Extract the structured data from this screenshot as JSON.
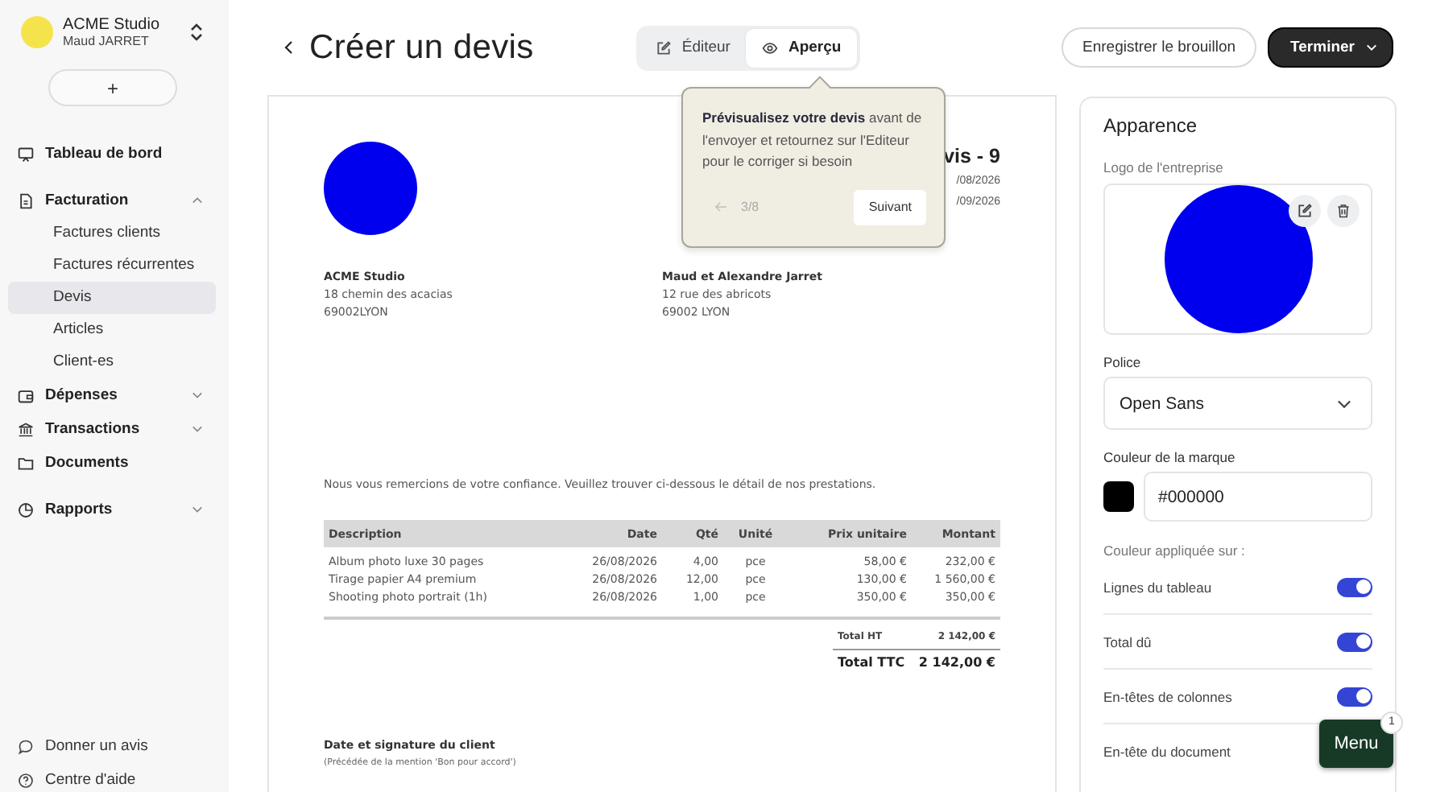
{
  "sidebar": {
    "org": {
      "name": "ACME Studio",
      "user": "Maud JARRET"
    },
    "add_button": "+",
    "nav": [
      {
        "label": "Tableau de bord",
        "selected": false
      },
      {
        "label": "Facturation",
        "selected": false,
        "expanded": true,
        "children": [
          {
            "label": "Factures clients",
            "selected": false
          },
          {
            "label": "Factures récurrentes",
            "selected": false
          },
          {
            "label": "Devis",
            "selected": true
          },
          {
            "label": "Articles",
            "selected": false
          },
          {
            "label": "Client-es",
            "selected": false
          }
        ]
      },
      {
        "label": "Dépenses",
        "selected": false,
        "expanded": false
      },
      {
        "label": "Transactions",
        "selected": false,
        "expanded": false
      },
      {
        "label": "Documents",
        "selected": false
      },
      {
        "label": "Rapports",
        "selected": false,
        "expanded": false
      }
    ],
    "footer_links": [
      "Donner un avis",
      "Centre d'aide"
    ]
  },
  "header": {
    "title": "Créer un devis",
    "view_tabs": [
      {
        "label": "Éditeur",
        "selected": false
      },
      {
        "label": "Aperçu",
        "selected": true
      }
    ],
    "save_draft": "Enregistrer le brouillon",
    "finish": "Terminer"
  },
  "tooltip": {
    "text": "**Prévisualisez votre devis** avant de l'envoyer et retournez sur l'Editeur pour le corriger si besoin",
    "step": "3/8",
    "next": "Suivant"
  },
  "document": {
    "title_partial": "vis - 9",
    "dates_partial": [
      "/08/2026",
      "/09/2026"
    ],
    "sender": {
      "name": "ACME Studio",
      "lines": [
        "18 chemin des acacias",
        "69002LYON"
      ]
    },
    "client": {
      "name": "Maud et Alexandre Jarret",
      "lines": [
        "12 rue des abricots",
        "69002 LYON"
      ]
    },
    "intro": "Nous vous remercions de votre confiance. Veuillez trouver ci-dessous le détail de nos prestations.",
    "table": {
      "columns": [
        "Description",
        "Date",
        "Qté",
        "Unité",
        "Prix unitaire",
        "Montant"
      ],
      "rows": [
        [
          "Album photo luxe 30 pages",
          "26/08/2026",
          "4,00",
          "pce",
          "58,00 €",
          "232,00 €"
        ],
        [
          "Tirage papier A4 premium",
          "26/08/2026",
          "12,00",
          "pce",
          "130,00 €",
          "1 560,00 €"
        ],
        [
          "Shooting photo portrait (1h)",
          "26/08/2026",
          "1,00",
          "pce",
          "350,00 €",
          "350,00 €"
        ]
      ]
    },
    "totals": [
      {
        "kind": "subtotal",
        "label": "Total HT",
        "value": "2 142,00 €"
      },
      {
        "kind": "grand",
        "label": "Total TTC",
        "value": "2 142,00 €"
      }
    ],
    "signature": {
      "title": "Date et signature du client",
      "note": "(Précédée de la mention 'Bon pour accord')"
    }
  },
  "appearance": {
    "title": "Apparence",
    "logo_label": "Logo de l'entreprise",
    "font": {
      "label": "Police",
      "value": "Open Sans"
    },
    "brand_color": {
      "label": "Couleur de la marque",
      "value": "#000000"
    },
    "applied_label": "Couleur appliquée sur :",
    "toggles": [
      {
        "label": "Lignes du tableau",
        "on": true
      },
      {
        "label": "Total dû",
        "on": true
      },
      {
        "label": "En-têtes de colonnes",
        "on": true
      },
      {
        "label": "En-tête du document"
      }
    ]
  },
  "help_menu": {
    "label": "Menu",
    "badge": "1"
  }
}
